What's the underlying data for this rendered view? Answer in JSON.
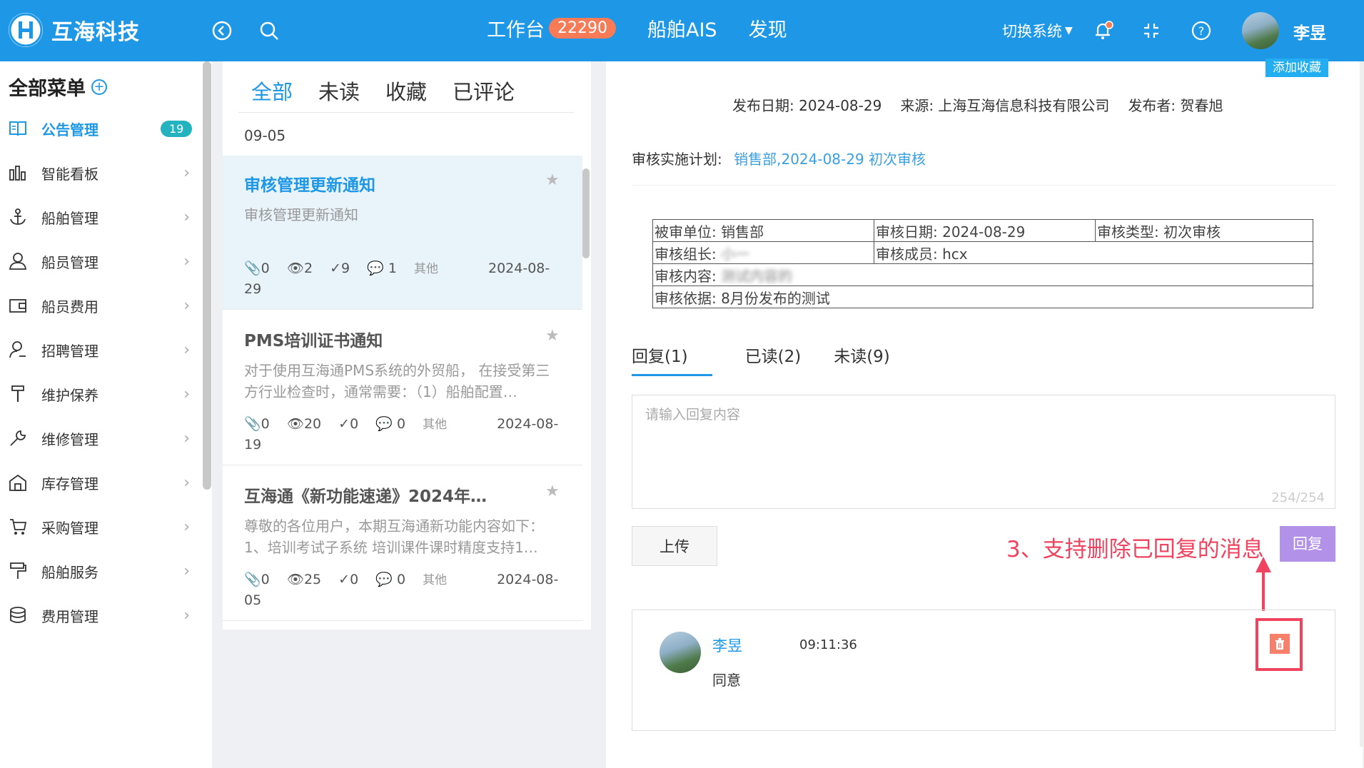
{
  "header": {
    "brand": "互海科技",
    "nav": [
      {
        "label": "工作台",
        "badge": "22290"
      },
      {
        "label": "船舶AIS"
      },
      {
        "label": "发现"
      }
    ],
    "switch_system": "切换系统",
    "user": "李昱",
    "bg_color": "#1e98e6"
  },
  "sidebar": {
    "title": "全部菜单",
    "items": [
      {
        "label": "公告管理",
        "icon": "notice-book-icon",
        "badge": "19"
      },
      {
        "label": "智能看板",
        "icon": "bar-chart-icon"
      },
      {
        "label": "船舶管理",
        "icon": "anchor-icon"
      },
      {
        "label": "船员管理",
        "icon": "person-icon"
      },
      {
        "label": "船员费用",
        "icon": "wallet-icon"
      },
      {
        "label": "招聘管理",
        "icon": "recruit-icon"
      },
      {
        "label": "维护保养",
        "icon": "paint-roller-icon"
      },
      {
        "label": "维修管理",
        "icon": "wrench-icon"
      },
      {
        "label": "库存管理",
        "icon": "warehouse-icon"
      },
      {
        "label": "采购管理",
        "icon": "cart-icon"
      },
      {
        "label": "船舶服务",
        "icon": "service-icon"
      },
      {
        "label": "费用管理",
        "icon": "coins-icon"
      }
    ]
  },
  "list": {
    "tabs": [
      "全部",
      "未读",
      "收藏",
      "已评论"
    ],
    "prev_date": "09-05",
    "cards": [
      {
        "title": "审核管理更新通知",
        "desc": "审核管理更新通知",
        "attach": "0",
        "views": "2",
        "read": "9",
        "comments": "1",
        "category": "其他",
        "date": "2024-08-29"
      },
      {
        "title": "PMS培训证书通知",
        "desc": "对于使用互海通PMS系统的外贸船， 在接受第三方行业检查时，通常需要：（1）船舶配置…",
        "attach": "0",
        "views": "20",
        "read": "0",
        "comments": "0",
        "category": "其他",
        "date": "2024-08-19"
      },
      {
        "title": "互海通《新功能速递》2024年…",
        "desc": "尊敬的各位用户，本期互海通新功能内容如下：1、培训考试子系统 培训课件课时精度支持1…",
        "attach": "0",
        "views": "25",
        "read": "0",
        "comments": "0",
        "category": "其他",
        "date": "2024-08-05"
      }
    ]
  },
  "detail": {
    "fav_button": "添加收藏",
    "publish_date": "发布日期: 2024-08-29",
    "source": "来源: 上海互海信息科技有限公司",
    "publisher": "发布者: 贺春旭",
    "audit_plan_label": "审核实施计划:",
    "audit_plan_link": "销售部,2024-08-29 初次审核",
    "table": {
      "unit_label": "被审单位:",
      "unit": "销售部",
      "date_label": "审核日期:",
      "date": "2024-08-29",
      "type_label": "审核类型:",
      "type": "初次审核",
      "leader_label": "审核组长:",
      "leader": "小一",
      "members_label": "审核成员:",
      "members": "hcx",
      "content_label": "审核内容:",
      "content": "测试内容的",
      "basis_label": "审核依据:",
      "basis": "8月份发布的测试"
    },
    "reply_tabs": [
      "回复(1)",
      "已读(2)",
      "未读(9)"
    ],
    "reply_placeholder": "请输入回复内容",
    "counter": "254/254",
    "upload": "上传",
    "reply_button": "回复",
    "annotation": "3、支持删除已回复的消息",
    "reply": {
      "name": "李昱",
      "time": "09:11:36",
      "text": "同意"
    }
  }
}
